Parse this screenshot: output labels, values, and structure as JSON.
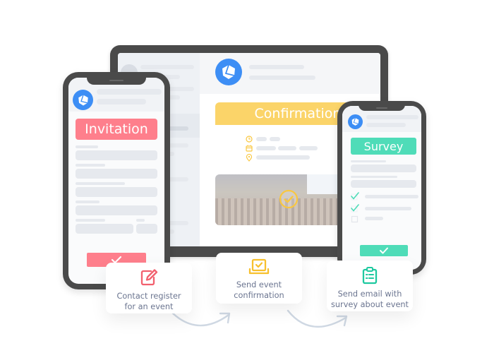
{
  "laptop": {
    "banner_title": "Confirmation",
    "event_details": [
      "time-row",
      "date-row",
      "location-row"
    ],
    "photo_alt": "Conference audience",
    "photo_overlay_icon": "check-circle-icon"
  },
  "phone_left": {
    "banner_title": "Invitation",
    "submit_icon": "check-icon"
  },
  "phone_right": {
    "banner_title": "Survey",
    "checklist": [
      {
        "checked": true
      },
      {
        "checked": true
      },
      {
        "checked": false
      }
    ],
    "submit_icon": "check-icon"
  },
  "steps": [
    {
      "icon": "edit-icon",
      "label_line1": "Contact register",
      "label_line2": "for an event",
      "color": "#f2606e"
    },
    {
      "icon": "laptop-check-icon",
      "label_line1": "Send event",
      "label_line2": "confirmation",
      "color": "#f7c02e"
    },
    {
      "icon": "clipboard-list-icon",
      "label_line1": "Send email with",
      "label_line2": "survey about event",
      "color": "#1fc9a0"
    }
  ],
  "colors": {
    "brand_blue": "#3d8ef5",
    "invitation_pink": "#fe7f8c",
    "confirmation_yellow": "#fbd469",
    "survey_green": "#4fdcb8",
    "arrow": "#cfd8e3",
    "label_text": "#6b7590"
  }
}
